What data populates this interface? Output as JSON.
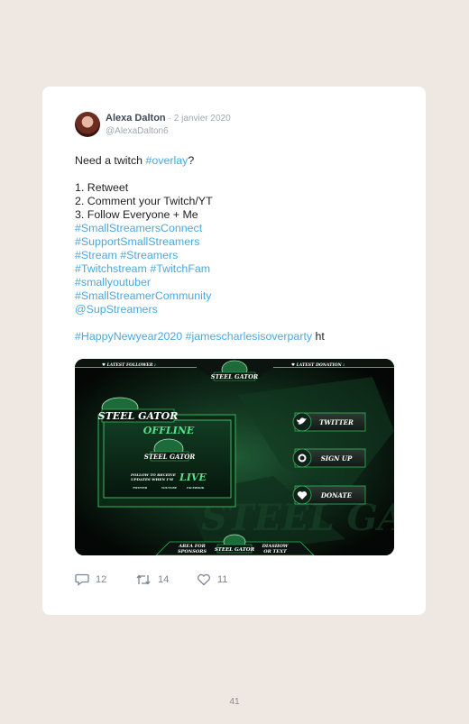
{
  "tweet": {
    "author_name": "Alexa Dalton",
    "date": "· 2 janvier 2020",
    "handle": "@AlexaDalton6",
    "lines": [
      {
        "segments": [
          {
            "t": "Need a twitch ",
            "tag": false
          },
          {
            "t": "#overlay",
            "tag": true
          },
          {
            "t": "?",
            "tag": false
          }
        ]
      },
      {
        "segments": []
      },
      {
        "segments": [
          {
            "t": "1. Retweet",
            "tag": false
          }
        ]
      },
      {
        "segments": [
          {
            "t": "2. Comment your Twitch/YT",
            "tag": false
          }
        ]
      },
      {
        "segments": [
          {
            "t": "3. Follow Everyone + Me",
            "tag": false
          }
        ]
      },
      {
        "segments": [
          {
            "t": "#SmallStreamersConnect",
            "tag": true
          }
        ]
      },
      {
        "segments": [
          {
            "t": "#SupportSmallStreamers",
            "tag": true
          }
        ]
      },
      {
        "segments": [
          {
            "t": "#Stream #Streamers",
            "tag": true
          }
        ]
      },
      {
        "segments": [
          {
            "t": "#Twitchstream #TwitchFam",
            "tag": true
          }
        ]
      },
      {
        "segments": [
          {
            "t": "#smallyoutuber",
            "tag": true
          }
        ]
      },
      {
        "segments": [
          {
            "t": "#SmallStreamerCommunity",
            "tag": true
          }
        ]
      },
      {
        "segments": [
          {
            "t": "@SupStreamers",
            "tag": true
          }
        ]
      },
      {
        "segments": []
      },
      {
        "segments": [
          {
            "t": "#HappyNewyear2020 #jamescharlesisoverparty",
            "tag": true
          },
          {
            "t": " ht",
            "tag": false
          }
        ]
      }
    ]
  },
  "overlay_image": {
    "latest_follower_label": "♥ LATEST FOLLOWER :",
    "latest_donation_label": "♥ LATEST DONATION :",
    "brand": "STEEL GATOR",
    "offline_label": "OFFLINE",
    "follow_text_line1": "FOLLOW TO RECEIVE",
    "follow_text_line2": "UPDATES WHEN I'M",
    "live_label": "LIVE",
    "socials": [
      "TWITTER",
      "YOUTUBE",
      "FACEBOOK"
    ],
    "buttons": [
      "TWITTER",
      "SIGN UP",
      "DONATE"
    ],
    "footer_left": "AREA FOR SPONSORS",
    "footer_right": "DIASHOW OR TEXT",
    "accent_color": "#2fb75a"
  },
  "actions": {
    "replies": "12",
    "retweets": "14",
    "likes": "11"
  },
  "page_number": "41"
}
